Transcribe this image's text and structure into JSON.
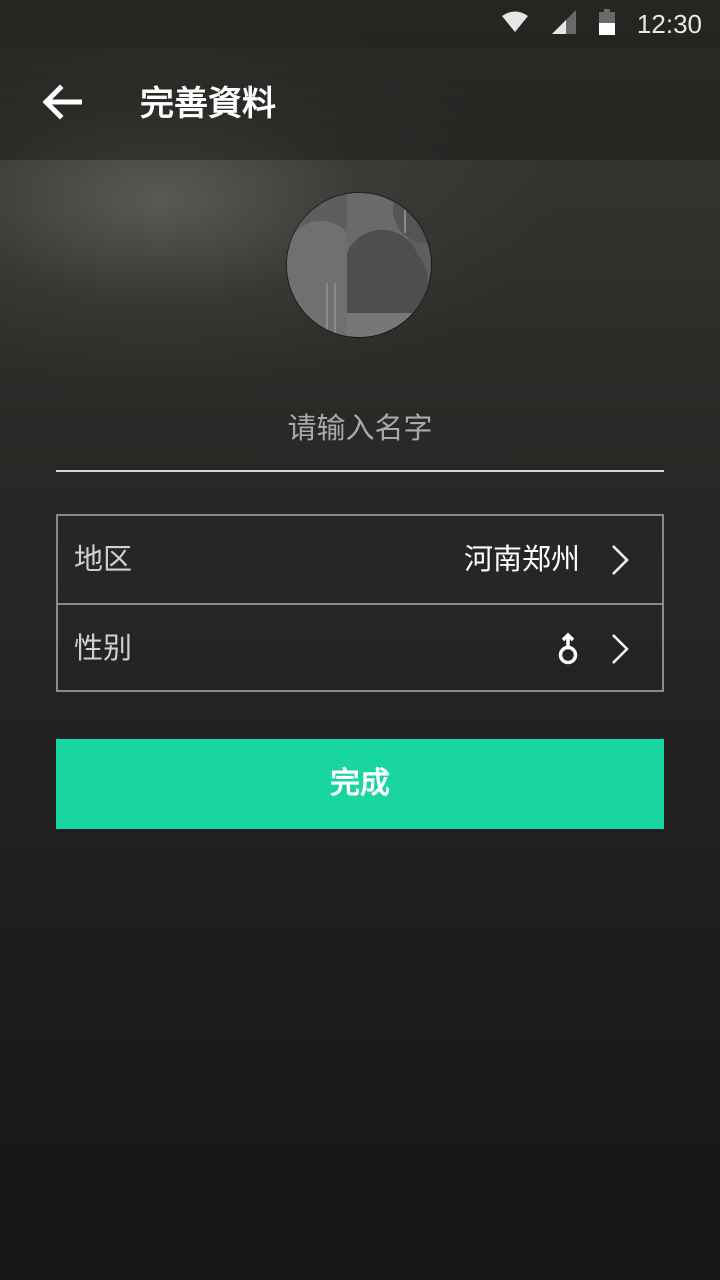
{
  "status_bar": {
    "time": "12:30",
    "icons": [
      "wifi-icon",
      "signal-icon",
      "battery-icon"
    ]
  },
  "app_bar": {
    "back_icon": "arrow-left-icon",
    "title": "完善資料"
  },
  "profile": {
    "avatar_icon": "avatar-image",
    "name_placeholder": "请输入名字",
    "name_value": ""
  },
  "form": {
    "region_label": "地区",
    "region_value": "河南郑州",
    "gender_label": "性别",
    "gender_icon": "male-symbol-icon",
    "chevron_icon": "chevron-right-icon"
  },
  "actions": {
    "done_label": "完成"
  },
  "colors": {
    "accent": "#19d6a0",
    "text_primary": "#ffffff",
    "text_secondary": "#a9a9a9",
    "border": "#8a8a8a"
  }
}
